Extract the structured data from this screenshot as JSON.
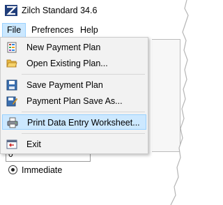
{
  "window": {
    "title": "Zilch Standard 34.6"
  },
  "menubar": {
    "items": [
      "File",
      "Prefrences",
      "Help"
    ]
  },
  "file_menu": {
    "items": [
      {
        "label": "New Payment Plan",
        "icon": "new-plan-icon"
      },
      {
        "label": "Open Existing Plan...",
        "icon": "folder-open-icon"
      },
      {
        "label": "Save Payment Plan",
        "icon": "save-icon"
      },
      {
        "label": "Payment Plan Save As...",
        "icon": "save-as-icon"
      },
      {
        "label": "Print Data Entry Worksheet...",
        "icon": "printer-icon",
        "highlighted": true
      },
      {
        "label": "Exit",
        "icon": "exit-icon"
      }
    ]
  },
  "background": {
    "field_value": "0",
    "radio_label": "Immediate"
  },
  "colors": {
    "highlight": "#cce8ff",
    "highlight_border": "#99d1ff",
    "menu_bg": "#f2f2f2"
  }
}
